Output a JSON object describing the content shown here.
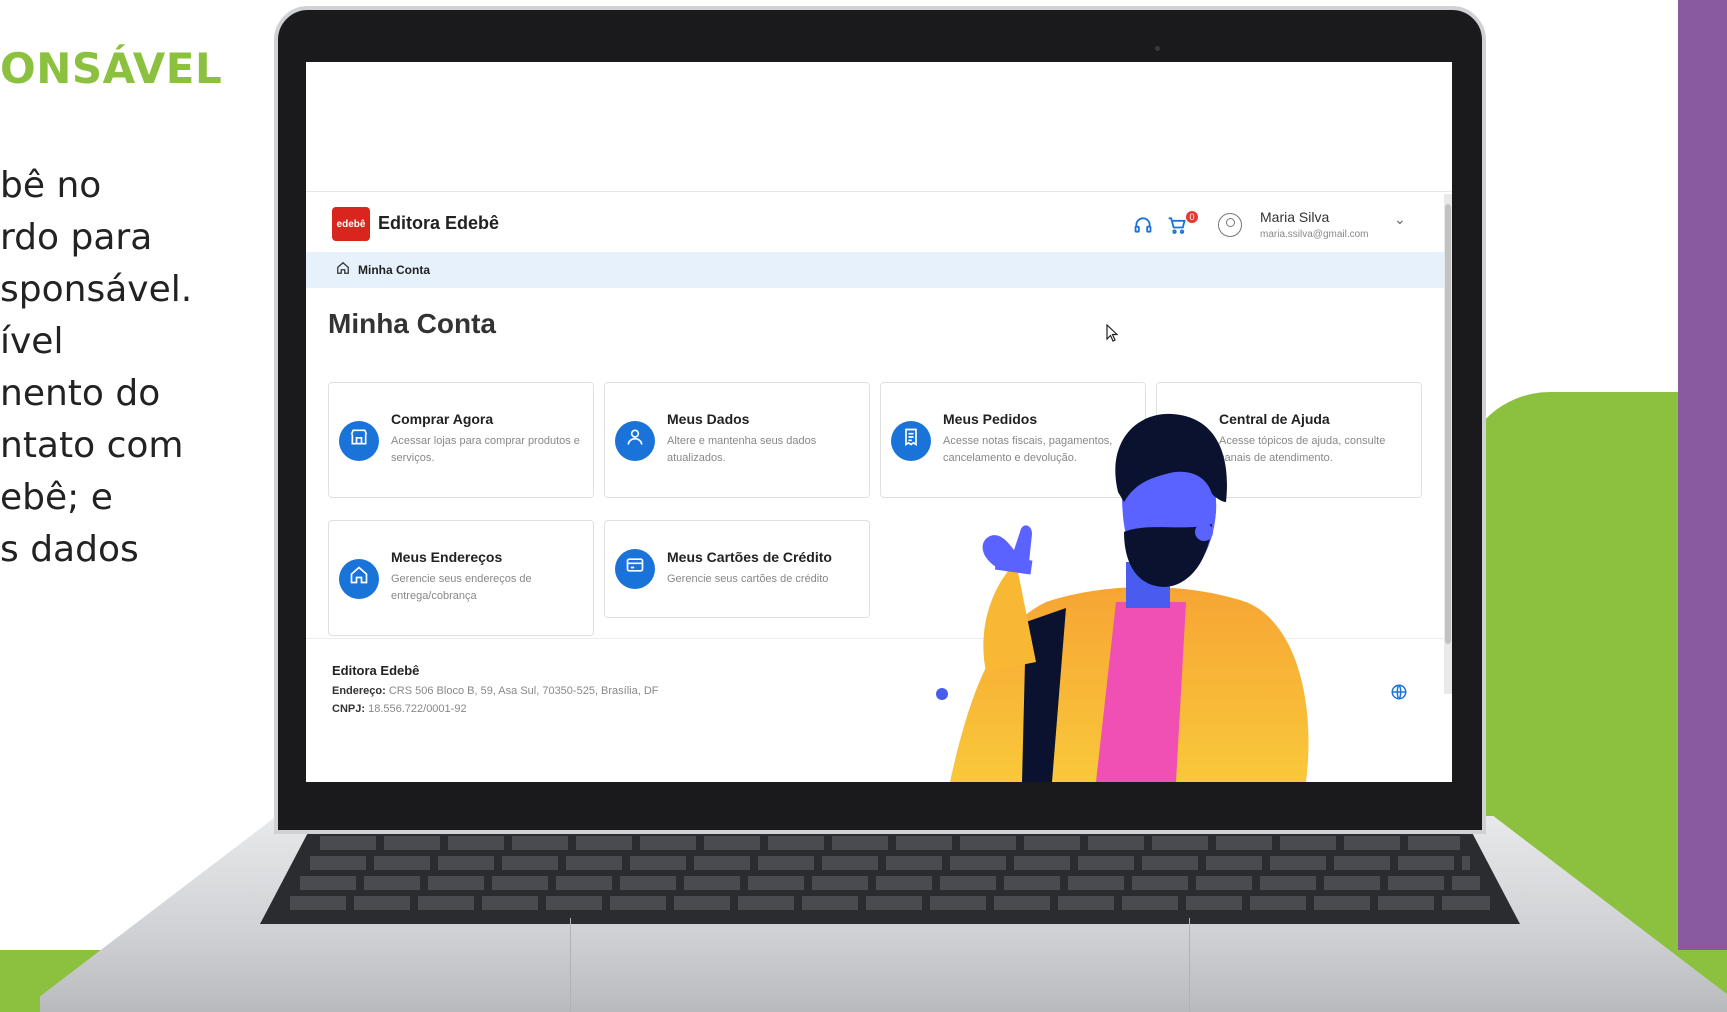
{
  "slide": {
    "title": "ONSÁVEL",
    "lines": [
      "bê no",
      "rdo para",
      "sponsável.",
      "ível",
      "nento do",
      "ntato com",
      "ebê; e",
      "s dados"
    ]
  },
  "app": {
    "logo_text": "edebê",
    "title": "Editora Edebê",
    "cart_count": "0",
    "user": {
      "name": "Maria Silva",
      "email": "maria.ssilva@gmail.com"
    }
  },
  "breadcrumb": {
    "label": "Minha Conta"
  },
  "page": {
    "title": "Minha Conta"
  },
  "cards": [
    {
      "title": "Comprar Agora",
      "desc": "Acessar lojas para comprar produtos e serviços.",
      "icon": "store-icon"
    },
    {
      "title": "Meus Dados",
      "desc": "Altere e mantenha seus dados atualizados.",
      "icon": "user-icon"
    },
    {
      "title": "Meus Pedidos",
      "desc": "Acesse notas fiscais, pagamentos, cancelamento e devolução.",
      "icon": "receipt-icon"
    },
    {
      "title": "Central de Ajuda",
      "desc": "Acesse tópicos de ajuda, consulte canais de atendimento.",
      "icon": "headset-icon"
    },
    {
      "title": "Meus Endereços",
      "desc": "Gerencie seus endereços de entrega/cobrança",
      "icon": "home-icon"
    },
    {
      "title": "Meus Cartões de Crédito",
      "desc": "Gerencie seus cartões de crédito",
      "icon": "credit-card-icon"
    }
  ],
  "footer": {
    "name": "Editora Edebê",
    "address_label": "Endereço:",
    "address": "CRS 506 Bloco B, 59, Asa Sul, 70350-525, Brasília, DF",
    "cnpj_label": "CNPJ:",
    "cnpj": "18.556.722/0001-92"
  },
  "colors": {
    "accent": "#1a73d9",
    "brand_red": "#d8261f",
    "slide_green": "#8cc13f",
    "slide_purple": "#8a5aa0"
  }
}
